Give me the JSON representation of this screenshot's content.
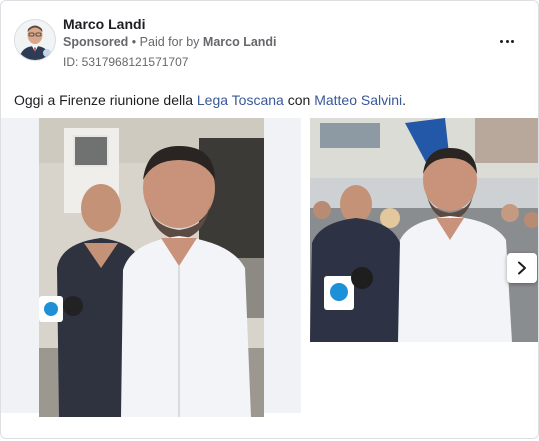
{
  "ad": {
    "page_name": "Marco Landi",
    "sponsored_label": "Sponsored",
    "separator": "•",
    "paid_for_prefix": "Paid for by",
    "paid_for_name": "Marco Landi",
    "id_text": "ID: 5317968121571707"
  },
  "post": {
    "text_before": "Oggi a Firenze riunione della ",
    "link1": "Lega Toscana",
    "text_middle": " con ",
    "link2": "Matteo Salvini",
    "text_after": "."
  },
  "media": {
    "photo1_icon": "person-photo-icon",
    "photo2_icon": "person-photo-icon",
    "next_icon": "chevron-right-icon"
  },
  "colors": {
    "link": "#385898",
    "secondary_text": "#65676b",
    "border": "#dddfe2"
  }
}
